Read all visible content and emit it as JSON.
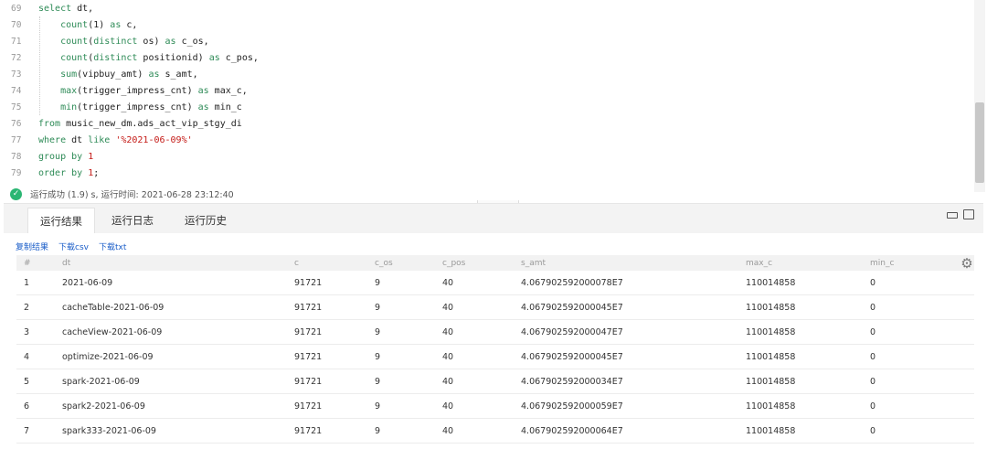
{
  "editor": {
    "lines": [
      {
        "n": "69",
        "parts": [
          [
            "kw",
            "select"
          ],
          [
            "t",
            " dt,"
          ]
        ]
      },
      {
        "n": "70",
        "parts": [
          [
            "t",
            "    "
          ],
          [
            "fn",
            "count"
          ],
          [
            "t",
            "(1) "
          ],
          [
            "kw",
            "as"
          ],
          [
            "t",
            " c,"
          ]
        ]
      },
      {
        "n": "71",
        "parts": [
          [
            "t",
            "    "
          ],
          [
            "fn",
            "count"
          ],
          [
            "t",
            "("
          ],
          [
            "kw",
            "distinct"
          ],
          [
            "t",
            " os) "
          ],
          [
            "kw",
            "as"
          ],
          [
            "t",
            " c_os,"
          ]
        ]
      },
      {
        "n": "72",
        "parts": [
          [
            "t",
            "    "
          ],
          [
            "fn",
            "count"
          ],
          [
            "t",
            "("
          ],
          [
            "kw",
            "distinct"
          ],
          [
            "t",
            " positionid) "
          ],
          [
            "kw",
            "as"
          ],
          [
            "t",
            " c_pos,"
          ]
        ]
      },
      {
        "n": "73",
        "parts": [
          [
            "t",
            "    "
          ],
          [
            "fn",
            "sum"
          ],
          [
            "t",
            "(vipbuy_amt) "
          ],
          [
            "kw",
            "as"
          ],
          [
            "t",
            " s_amt,"
          ]
        ]
      },
      {
        "n": "74",
        "parts": [
          [
            "t",
            "    "
          ],
          [
            "fn",
            "max"
          ],
          [
            "t",
            "(trigger_impress_cnt) "
          ],
          [
            "kw",
            "as"
          ],
          [
            "t",
            " max_c,"
          ]
        ]
      },
      {
        "n": "75",
        "parts": [
          [
            "t",
            "    "
          ],
          [
            "fn",
            "min"
          ],
          [
            "t",
            "(trigger_impress_cnt) "
          ],
          [
            "kw",
            "as"
          ],
          [
            "t",
            " min_c"
          ]
        ]
      },
      {
        "n": "76",
        "parts": [
          [
            "kw",
            "from"
          ],
          [
            "t",
            " music_new_dm.ads_act_vip_stgy_di"
          ]
        ]
      },
      {
        "n": "77",
        "parts": [
          [
            "kw",
            "where"
          ],
          [
            "t",
            " dt "
          ],
          [
            "kw",
            "like"
          ],
          [
            "t",
            " "
          ],
          [
            "str",
            "'%2021-06-09%'"
          ]
        ]
      },
      {
        "n": "78",
        "parts": [
          [
            "kw",
            "group by"
          ],
          [
            "t",
            " "
          ],
          [
            "num",
            "1"
          ]
        ]
      },
      {
        "n": "79",
        "parts": [
          [
            "kw",
            "order by"
          ],
          [
            "t",
            " "
          ],
          [
            "num",
            "1"
          ],
          [
            "t",
            ";"
          ]
        ]
      }
    ]
  },
  "status": {
    "text": "运行成功 (1.9) s,  运行时间:  2021-06-28 23:12:40"
  },
  "tabs": [
    "运行结果",
    "运行日志",
    "运行历史"
  ],
  "links": [
    "复制结果",
    "下载csv",
    "下载txt"
  ],
  "table": {
    "headers": [
      "#",
      "dt",
      "c",
      "c_os",
      "c_pos",
      "s_amt",
      "max_c",
      "min_c"
    ],
    "rows": [
      [
        "1",
        "2021-06-09",
        "91721",
        "9",
        "40",
        "4.067902592000078E7",
        "110014858",
        "0"
      ],
      [
        "2",
        "cacheTable-2021-06-09",
        "91721",
        "9",
        "40",
        "4.067902592000045E7",
        "110014858",
        "0"
      ],
      [
        "3",
        "cacheView-2021-06-09",
        "91721",
        "9",
        "40",
        "4.067902592000047E7",
        "110014858",
        "0"
      ],
      [
        "4",
        "optimize-2021-06-09",
        "91721",
        "9",
        "40",
        "4.067902592000045E7",
        "110014858",
        "0"
      ],
      [
        "5",
        "spark-2021-06-09",
        "91721",
        "9",
        "40",
        "4.067902592000034E7",
        "110014858",
        "0"
      ],
      [
        "6",
        "spark2-2021-06-09",
        "91721",
        "9",
        "40",
        "4.067902592000059E7",
        "110014858",
        "0"
      ],
      [
        "7",
        "spark333-2021-06-09",
        "91721",
        "9",
        "40",
        "4.067902592000064E7",
        "110014858",
        "0"
      ]
    ]
  },
  "colors": {
    "keyword": "#2e8b57",
    "string": "#c41a16",
    "success": "#2bb673",
    "link": "#1a5dc8"
  },
  "icons": {
    "status": "check-circle-icon",
    "settings": "gear-icon",
    "minimize": "minimize-icon",
    "maximize": "maximize-icon"
  }
}
